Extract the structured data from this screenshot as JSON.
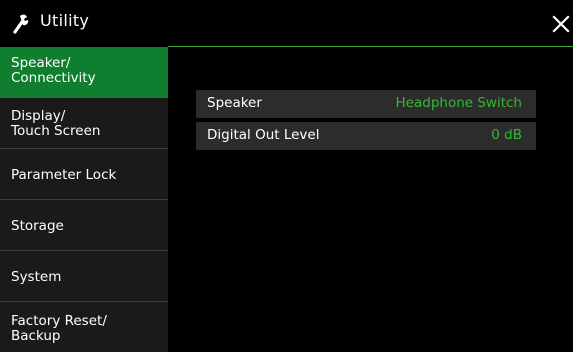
{
  "header": {
    "title": "Utility",
    "title_icon": "wrench-icon",
    "close_icon": "close-icon"
  },
  "sidebar": {
    "items": [
      {
        "label": "Speaker/\nConnectivity",
        "active": true
      },
      {
        "label": "Display/\nTouch Screen",
        "active": false
      },
      {
        "label": "Parameter Lock",
        "active": false
      },
      {
        "label": "Storage",
        "active": false
      },
      {
        "label": "System",
        "active": false
      },
      {
        "label": "Factory Reset/\nBackup",
        "active": false
      }
    ]
  },
  "settings": [
    {
      "label": "Speaker",
      "value": "Headphone Switch"
    },
    {
      "label": "Digital Out Level",
      "value": "0 dB"
    }
  ],
  "colors": {
    "accent_green": "#0f7f2f",
    "value_green": "#33b833",
    "panel_bg": "#2c2c2c"
  }
}
